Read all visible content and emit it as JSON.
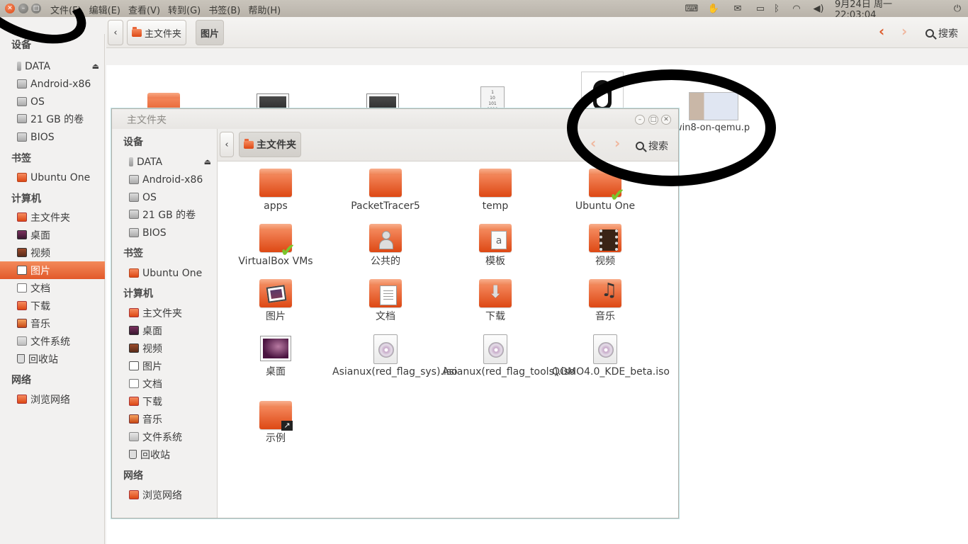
{
  "top_panel": {
    "menus": [
      "文件(F)",
      "编辑(E)",
      "查看(V)",
      "转到(G)",
      "书签(B)",
      "帮助(H)"
    ],
    "datetime": "9月24日 周一　22:03:04"
  },
  "back_window": {
    "breadcrumb": [
      "主文件夹",
      "图片"
    ],
    "search_label": "搜索",
    "sidebar": {
      "devices_header": "设备",
      "devices": [
        "DATA",
        "Android-x86",
        "OS",
        "21 GB 的卷",
        "BIOS"
      ],
      "bookmarks_header": "书签",
      "bookmarks": [
        "Ubuntu One"
      ],
      "computer_header": "计算机",
      "computer": [
        "主文件夹",
        "桌面",
        "视频",
        "图片",
        "文档",
        "下载",
        "音乐",
        "文件系统",
        "回收站"
      ],
      "selected": "图片",
      "network_header": "网络",
      "network": [
        "浏览网络"
      ]
    },
    "visible_file_label": "win8-on-qemu.p"
  },
  "front_window": {
    "title": "主文件夹",
    "breadcrumb": "主文件夹",
    "search_label": "搜索",
    "sidebar": {
      "devices_header": "设备",
      "devices": [
        "DATA",
        "Android-x86",
        "OS",
        "21 GB 的卷",
        "BIOS"
      ],
      "bookmarks_header": "书签",
      "bookmarks": [
        "Ubuntu One"
      ],
      "computer_header": "计算机",
      "computer": [
        "主文件夹",
        "桌面",
        "视频",
        "图片",
        "文档",
        "下载",
        "音乐",
        "文件系统",
        "回收站"
      ],
      "network_header": "网络",
      "network": [
        "浏览网络"
      ]
    },
    "items": [
      {
        "label": "apps",
        "icon": "folder"
      },
      {
        "label": "PacketTracer5",
        "icon": "folder"
      },
      {
        "label": "temp",
        "icon": "folder"
      },
      {
        "label": "Ubuntu One",
        "icon": "folder-synced"
      },
      {
        "label": "VirtualBox VMs",
        "icon": "folder-synced"
      },
      {
        "label": "公共的",
        "icon": "folder-public"
      },
      {
        "label": "模板",
        "icon": "folder-templates"
      },
      {
        "label": "视频",
        "icon": "folder-videos"
      },
      {
        "label": "图片",
        "icon": "folder-pictures"
      },
      {
        "label": "文档",
        "icon": "folder-documents"
      },
      {
        "label": "下载",
        "icon": "folder-downloads"
      },
      {
        "label": "音乐",
        "icon": "folder-music"
      },
      {
        "label": "桌面",
        "icon": "desktop"
      },
      {
        "label": "Asianux(red_flag_sys).iso",
        "icon": "disc-image"
      },
      {
        "label": "Asianux(red_flag_tools).iso",
        "icon": "disc-image"
      },
      {
        "label": "QOMO4.0_KDE_beta.iso",
        "icon": "disc-image"
      },
      {
        "label": "示例",
        "icon": "folder-link"
      }
    ]
  }
}
